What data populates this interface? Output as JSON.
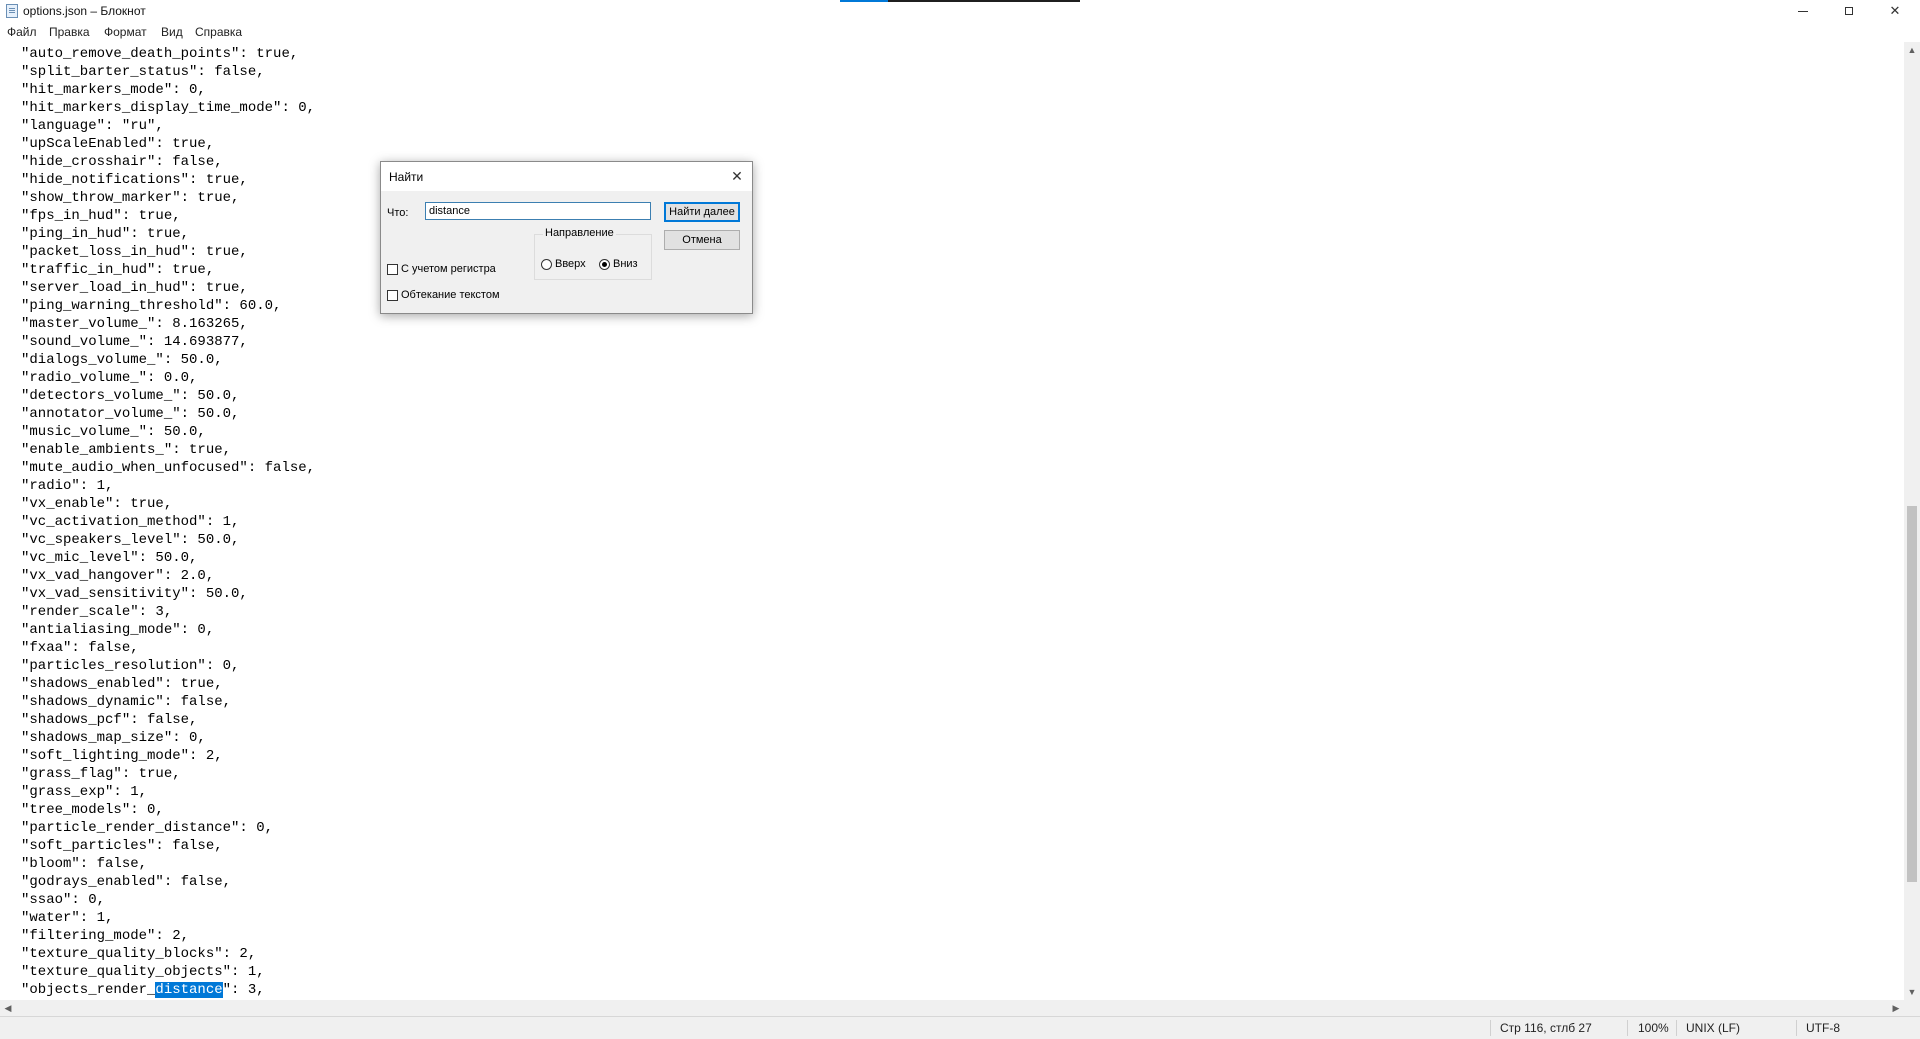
{
  "window": {
    "title": "options.json – Блокнот",
    "icon": "notepad-icon"
  },
  "menu": {
    "items": [
      "Файл",
      "Правка",
      "Формат",
      "Вид",
      "Справка"
    ]
  },
  "editor": {
    "lines": [
      "\"auto_remove_death_points\": true,",
      "\"split_barter_status\": false,",
      "\"hit_markers_mode\": 0,",
      "\"hit_markers_display_time_mode\": 0,",
      "\"language\": \"ru\",",
      "\"upScaleEnabled\": true,",
      "\"hide_crosshair\": false,",
      "\"hide_notifications\": true,",
      "\"show_throw_marker\": true,",
      "\"fps_in_hud\": true,",
      "\"ping_in_hud\": true,",
      "\"packet_loss_in_hud\": true,",
      "\"traffic_in_hud\": true,",
      "\"server_load_in_hud\": true,",
      "\"ping_warning_threshold\": 60.0,",
      "\"master_volume_\": 8.163265,",
      "\"sound_volume_\": 14.693877,",
      "\"dialogs_volume_\": 50.0,",
      "\"radio_volume_\": 0.0,",
      "\"detectors_volume_\": 50.0,",
      "\"annotator_volume_\": 50.0,",
      "\"music_volume_\": 50.0,",
      "\"enable_ambients_\": true,",
      "\"mute_audio_when_unfocused\": false,",
      "\"radio\": 1,",
      "\"vx_enable\": true,",
      "\"vc_activation_method\": 1,",
      "\"vc_speakers_level\": 50.0,",
      "\"vc_mic_level\": 50.0,",
      "\"vx_vad_hangover\": 2.0,",
      "\"vx_vad_sensitivity\": 50.0,",
      "\"render_scale\": 3,",
      "\"antialiasing_mode\": 0,",
      "\"fxaa\": false,",
      "\"particles_resolution\": 0,",
      "\"shadows_enabled\": true,",
      "\"shadows_dynamic\": false,",
      "\"shadows_pcf\": false,",
      "\"shadows_map_size\": 0,",
      "\"soft_lighting_mode\": 2,",
      "\"grass_flag\": true,",
      "\"grass_exp\": 1,",
      "\"tree_models\": 0,",
      "\"particle_render_distance\": 0,",
      "\"soft_particles\": false,",
      "\"bloom\": false,",
      "\"godrays_enabled\": false,",
      "\"ssao\": 0,",
      "\"water\": 1,",
      "\"filtering_mode\": 2,",
      "\"texture_quality_blocks\": 2,",
      "\"texture_quality_objects\": 1,"
    ],
    "last_line": {
      "before": "\"objects_render_",
      "highlighted": "distance",
      "after": "\": 3,"
    },
    "annotation_color": "#d9141e",
    "selection_color": "#0078d7"
  },
  "find_dialog": {
    "title": "Найти",
    "what_label": "Что:",
    "query": "distance",
    "find_next_label": "Найти далее",
    "cancel_label": "Отмена",
    "direction_label": "Направление",
    "up_label": "Вверх",
    "down_label": "Вниз",
    "direction_selected": "down",
    "match_case_label": "С учетом регистра",
    "wrap_label": "Обтекание текстом"
  },
  "statusbar": {
    "position": "Стр 116, стлб 27",
    "zoom": "100%",
    "line_endings": "UNIX (LF)",
    "encoding": "UTF-8"
  }
}
